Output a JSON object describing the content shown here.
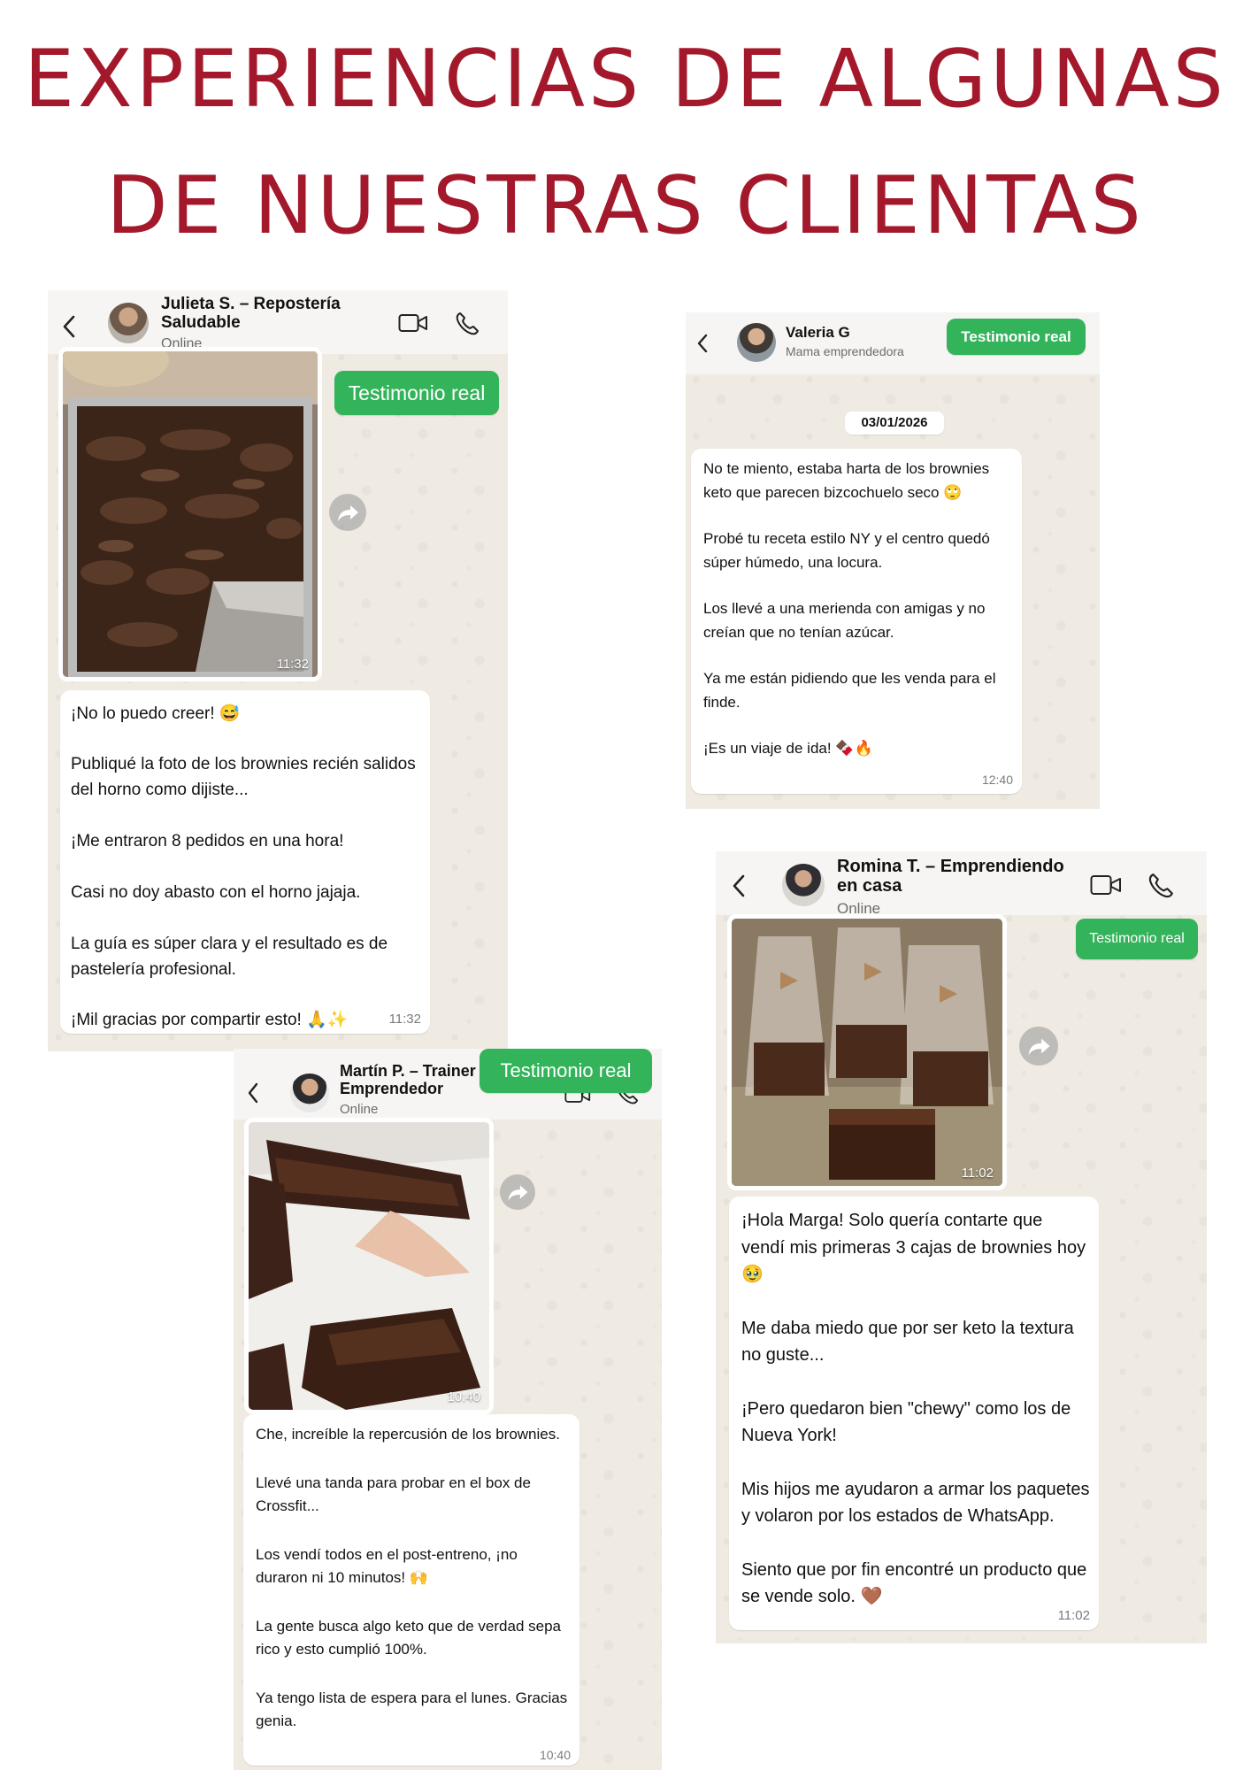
{
  "title": {
    "line1": "EXPERIENCIAS DE ALGUNAS",
    "line2": "DE NUESTRAS CLIENTAS"
  },
  "colors": {
    "title": "#a3192b",
    "badge": "#33b35a",
    "chat_bg": "#efeae2",
    "bubble": "#ffffff"
  },
  "chats": {
    "julieta": {
      "name_line1": "Julieta S. – Repostería",
      "name_line2": "Saludable",
      "status": "Online",
      "badge": "Testimonio real",
      "photo_time": "11:32",
      "message": [
        "¡No lo puedo creer! 😅",
        "Publiqué la foto de los brownies recién salidos del horno como dijiste...",
        "¡Me entraron 8 pedidos en una hora!",
        "Casi no doy abasto con el horno jajaja.",
        "La guía es súper clara y el resultado es de pastelería profesional.",
        "¡Mil gracias por compartir esto! 🙏✨"
      ],
      "time": "11:32"
    },
    "valeria": {
      "name": "Valeria G",
      "subtitle": "Mama emprendedora",
      "badge": "Testimonio real",
      "date": "03/01/2026",
      "message": [
        "No te miento, estaba harta de los brownies keto que parecen bizcochuelo seco 🙄",
        "Probé tu receta estilo NY y el centro quedó súper húmedo, una locura.",
        "Los llevé a una merienda con amigas y no creían que no tenían azúcar.",
        "Ya me están pidiendo que les venda para el finde.",
        "¡Es un viaje de ida! 🍫🔥"
      ],
      "time": "12:40"
    },
    "romina": {
      "name_line1": "Romina T. – Emprendiendo",
      "name_line2": "en casa",
      "status": "Online",
      "badge": "Testimonio real",
      "photo_time": "11:02",
      "message": [
        "¡Hola Marga! Solo quería contarte que vendí mis primeras 3 cajas de brownies hoy 🥹",
        "Me daba miedo que por ser keto la textura no guste...",
        "¡Pero quedaron bien \"chewy\" como los de Nueva York!",
        "Mis hijos me ayudaron a armar los paquetes y volaron por los estados de WhatsApp.",
        "Siento que por fin encontré un producto que se vende solo. 🤎"
      ],
      "time": "11:02"
    },
    "martin": {
      "name_line1": "Martín P. – Trainer",
      "name_line2": "Emprendedor",
      "status": "Online",
      "badge": "Testimonio real",
      "photo_time": "10:40",
      "message": [
        "Che, increíble la repercusión de los brownies.",
        "Llevé una tanda para probar en el box de Crossfit...",
        "Los vendí todos en el post-entreno, ¡no duraron ni 10 minutos! 🙌",
        "La gente busca algo keto que de verdad sepa rico y esto cumplió 100%.",
        "Ya tengo lista de espera para el lunes. Gracias genia."
      ],
      "time": "10:40"
    }
  }
}
